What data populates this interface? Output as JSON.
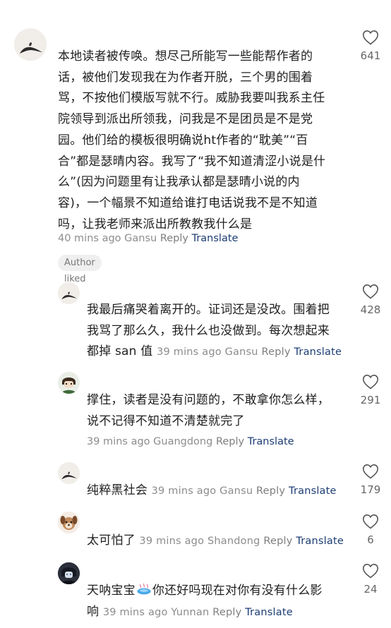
{
  "comments": [
    {
      "text_lines": [
        "本地读者被传唤。想尽己所能写一些能帮作者的",
        "话，被他们发现我在为作者开脱，三个男的围着",
        "骂，不按他们模版写就不行。威胁我要叫我系主任",
        "院领导到派出所领我，问我是不是团员是不是党",
        "园。他们给的模板很明确说ht作者的“耽美”“百",
        "合”都是瑟晴内容。我写了“我不知道清涩小说是什",
        "么”(因为问题里有让我承认都是瑟晴小说的内",
        "容)，一个幅景不知道给谁打电话说我不是不知道",
        "吗，让我老师来派出所教教我什么是"
      ],
      "time": "40 mins ago",
      "location": "Gansu",
      "reply": "Reply",
      "translate": "Translate",
      "badge": "Author liked",
      "likes": "641"
    }
  ],
  "replies": [
    {
      "text_lines": [
        "我最后痛哭着离开的。证词还是没改。围着把",
        "我骂了那么久，我什么也没做到。每次想起来",
        "都掉 san 值"
      ],
      "time": "39 mins ago",
      "location": "Gansu",
      "reply": "Reply",
      "translate": "Translate",
      "likes": "428"
    },
    {
      "text_lines": [
        "撑住，读者是没有问题的，不敢拿你怎么样，",
        "说不记得不知道不清楚就完了"
      ],
      "time": "39 mins ago",
      "location": "Guangdong",
      "reply": "Reply",
      "translate": "Translate",
      "likes": "291"
    },
    {
      "text_lines": [
        "纯粹黑社会"
      ],
      "time": "39 mins ago",
      "location": "Gansu",
      "reply": "Reply",
      "translate": "Translate",
      "likes": "179"
    },
    {
      "text_lines": [
        "太可怕了"
      ],
      "time": "39 mins ago",
      "location": "Shandong",
      "reply": "Reply",
      "translate": "Translate",
      "likes": "6"
    },
    {
      "text_before_emoji": "天呐宝宝",
      "text_after_emoji": "你还好吗现在对你有没有什么影",
      "text_line2": "响",
      "emoji_icon": "hot-spring-emoji",
      "time": "39 mins ago",
      "location": "Yunnan",
      "reply": "Reply",
      "translate": "Translate",
      "likes": "24"
    }
  ],
  "colors": {
    "translate": "#1c3d73",
    "meta": "#8c8c8c",
    "text": "#1f1f1f"
  }
}
